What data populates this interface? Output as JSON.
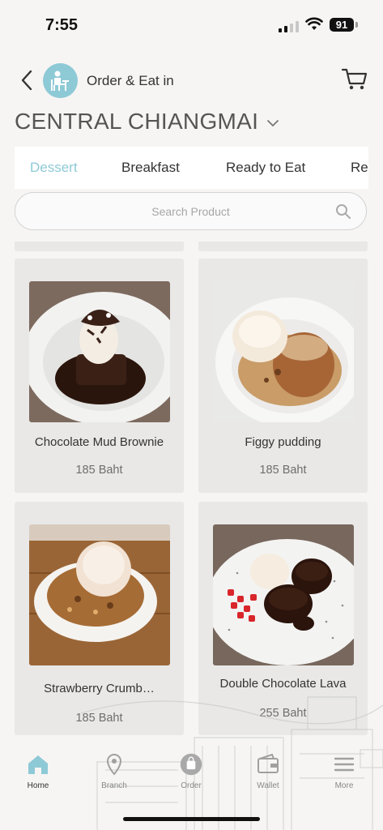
{
  "status_bar": {
    "time": "7:55",
    "battery": "91"
  },
  "header": {
    "title": "Order & Eat in",
    "branch": "CENTRAL CHIANGMAI"
  },
  "category_tabs": [
    {
      "label": "Dessert",
      "active": true
    },
    {
      "label": "Breakfast",
      "active": false
    },
    {
      "label": "Ready to Eat",
      "active": false
    },
    {
      "label": "Re",
      "active": false
    }
  ],
  "search": {
    "placeholder": "Search Product"
  },
  "products": [
    {
      "name": "Chocolate Mud Brownie",
      "price": "185 Baht"
    },
    {
      "name": "Figgy pudding",
      "price": "185 Baht"
    },
    {
      "name": "Strawberry Crumb…",
      "price": "185 Baht"
    },
    {
      "name": "Double Chocolate Lava",
      "price": "255 Baht"
    }
  ],
  "tab_bar": [
    {
      "label": "Home",
      "icon": "home-icon",
      "active": true
    },
    {
      "label": "Branch",
      "icon": "location-pin-icon",
      "active": false
    },
    {
      "label": "Order",
      "icon": "order-bag-icon",
      "active": false
    },
    {
      "label": "Wallet",
      "icon": "wallet-icon",
      "active": false
    },
    {
      "label": "More",
      "icon": "menu-icon",
      "active": false
    }
  ],
  "colors": {
    "accent": "#8ec9d6",
    "card_bg": "#e9e8e6",
    "page_bg": "#f6f5f3"
  }
}
